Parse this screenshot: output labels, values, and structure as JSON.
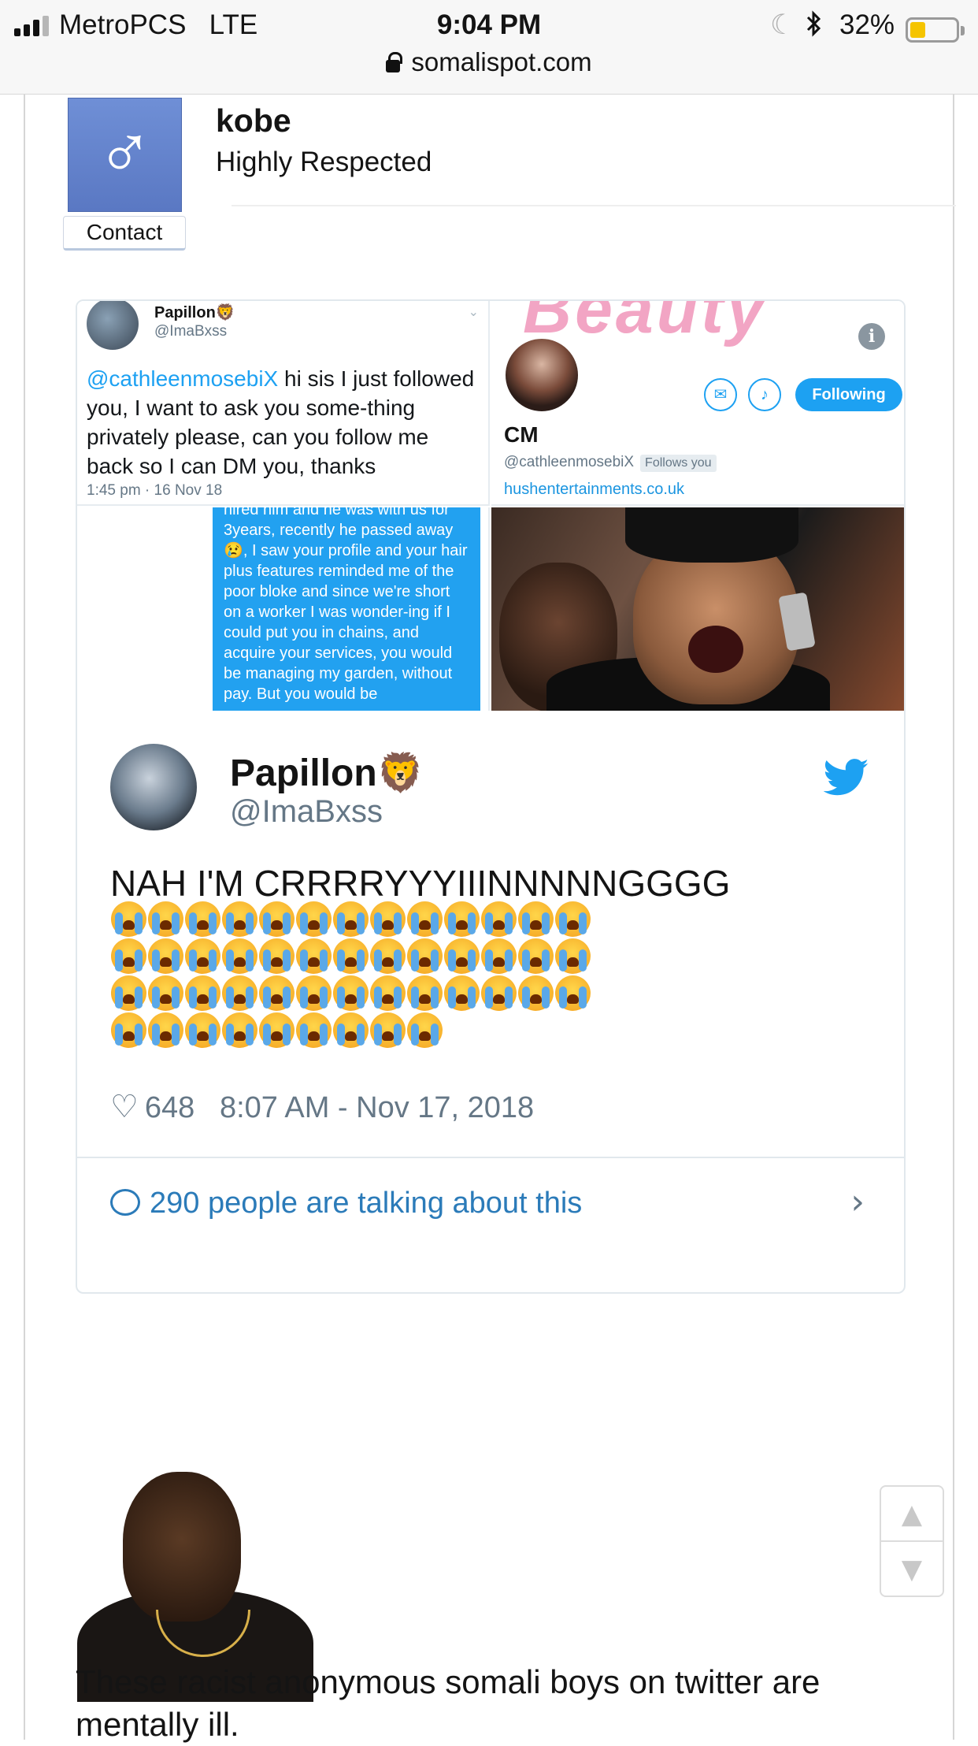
{
  "status_bar": {
    "carrier": "MetroPCS",
    "network": "LTE",
    "time": "9:04 PM",
    "battery": "32%",
    "battery_level": 0.32,
    "url": "somalispot.com"
  },
  "user": {
    "name": "kobe",
    "title": "Highly Respected",
    "avatar_symbol": "♂",
    "contact_label": "Contact"
  },
  "embed": {
    "screenshot_tweet": {
      "name": "Papillon🦁",
      "handle": "@ImaBxss",
      "mention": "@cathleenmosebiX",
      "text": " hi sis I just followed you, I want to ask you some-thing privately please, can you follow me back so I can DM you, thanks",
      "time": "1:45 pm · 16 Nov 18"
    },
    "profile": {
      "banner_text": "Beauty",
      "info_icon": "i",
      "following_label": "Following",
      "name": "CM",
      "handle": "@cathleenmosebiX",
      "follows_you": "Follows you",
      "link": "hushentertainments.co.uk"
    },
    "dm_text": "hired him and he was with us for 3years, recently he passed away 😢, I saw your profile and your hair plus features reminded me of the poor bloke and since we're short on a worker I was wonder-ing if I could put you in chains, and acquire your services, you would be managing my garden, without pay. But you would be",
    "tweet": {
      "name": "Papillon🦁",
      "handle": "@ImaBxss",
      "text": "NAH I'M CRRRRYYYIIINNNNNGGGG",
      "emoji_name": "loudly-crying-face",
      "emoji_count": 48,
      "likes": "648",
      "datetime": "8:07 AM - Nov 17, 2018",
      "talking": "290 people are talking about this"
    }
  },
  "scroll": {
    "up": "▲",
    "down": "▼"
  },
  "post_text": "These racist anonymous somali boys on twitter are mentally ill."
}
